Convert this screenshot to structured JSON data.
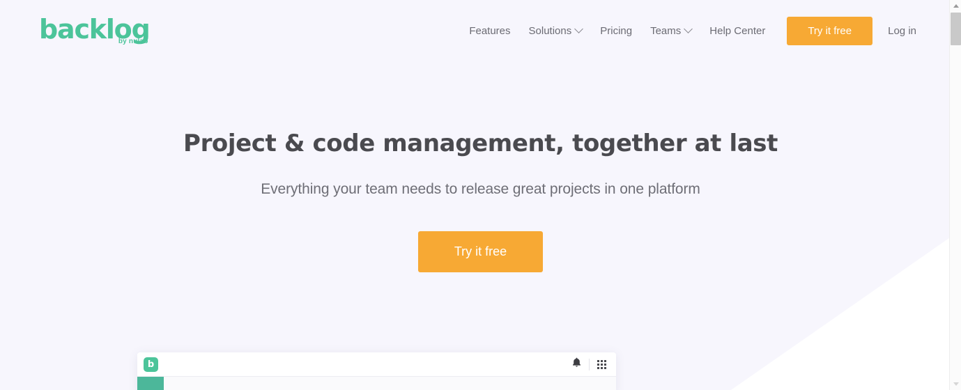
{
  "page": {
    "background_color": "#f7f6fd",
    "accent_orange": "#f7a934",
    "brand_green": "#4cc49a"
  },
  "header": {
    "logo": {
      "word": "backlog",
      "tagline": "by nulab"
    },
    "nav_items": [
      {
        "label": "Features",
        "has_dropdown": false
      },
      {
        "label": "Solutions",
        "has_dropdown": true
      },
      {
        "label": "Pricing",
        "has_dropdown": false
      },
      {
        "label": "Teams",
        "has_dropdown": true
      },
      {
        "label": "Help Center",
        "has_dropdown": false
      }
    ],
    "cta_label": "Try it free",
    "login_label": "Log in"
  },
  "hero": {
    "headline": "Project & code management, together at last",
    "subheadline": "Everything your team needs to release great projects in one platform",
    "cta_label": "Try it free"
  },
  "app_preview": {
    "logo_letter": "b",
    "notification_icon": "bell-icon",
    "apps_icon": "grid-icon"
  },
  "scrollbar": {
    "up_arrow": "scroll-up-arrow",
    "down_arrow": "scroll-down-arrow"
  }
}
